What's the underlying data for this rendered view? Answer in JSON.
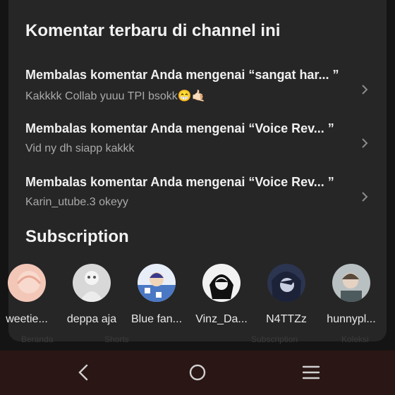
{
  "recent_comments": {
    "title": "Komentar terbaru di channel ini",
    "items": [
      {
        "title": "Membalas komentar Anda mengenai “sangat har... ”",
        "snippet": "Kakkkk Collab yuuu TPI bsokk😁🤙🏻"
      },
      {
        "title": "Membalas komentar Anda mengenai “Voice Rev... ”",
        "snippet": "Vid ny dh siapp kakkk"
      },
      {
        "title": "Membalas komentar Anda mengenai “Voice Rev... ”",
        "snippet": "Karin_utube.3 okeyy"
      }
    ]
  },
  "subscription": {
    "title": "Subscription",
    "channels": [
      {
        "name": "weetie...",
        "color": "#f3c7b8"
      },
      {
        "name": "deppa aja",
        "color": "#cfcfcf"
      },
      {
        "name": "Blue fan...",
        "color": "#7a9fd6"
      },
      {
        "name": "Vinz_Da...",
        "color": "#1a1a1a"
      },
      {
        "name": "N4TTZz",
        "color": "#3b4a6b"
      },
      {
        "name": "hunnypl...",
        "color": "#9aa3a6"
      }
    ]
  },
  "bottom_tabs_obscured": [
    "Beranda",
    "Shorts",
    "Subscription",
    "Koleksi"
  ],
  "system_nav": {
    "back": "back-icon",
    "home": "home-icon",
    "recents": "recents-icon"
  }
}
